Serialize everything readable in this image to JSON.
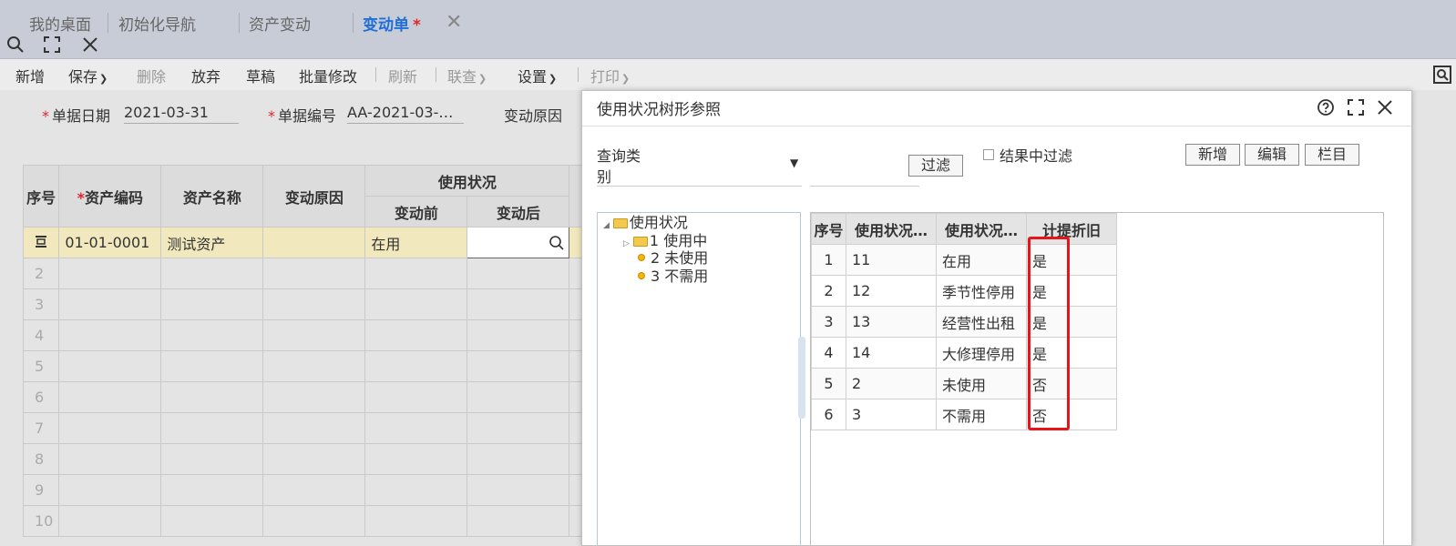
{
  "tabs": [
    {
      "label": "我的桌面"
    },
    {
      "label": "初始化导航"
    },
    {
      "label": "资产变动"
    },
    {
      "label": "变动单",
      "star": "*"
    }
  ],
  "toolbar": {
    "add": "新增",
    "save": "保存",
    "delete": "删除",
    "discard": "放弃",
    "draft": "草稿",
    "batch_edit": "批量修改",
    "refresh": "刷新",
    "link_query": "联查",
    "settings": "设置",
    "print": "打印"
  },
  "form": {
    "doc_date_label": "单据日期",
    "doc_date_value": "2021-03-31",
    "doc_no_label": "单据编号",
    "doc_no_value": "AA-2021-03-…",
    "reason_label": "变动原因",
    "required_mark": "*"
  },
  "grid": {
    "headers": {
      "seq": "序号",
      "asset_code": "资产编码",
      "asset_name": "资产名称",
      "reason": "变动原因",
      "usage": "使用状况",
      "before": "变动前",
      "after": "变动后"
    },
    "row1": {
      "code": "01-01-0001",
      "name": "测试资产",
      "before": "在用"
    },
    "row_numbers": [
      "2",
      "3",
      "4",
      "5",
      "6",
      "7",
      "8",
      "9",
      "10"
    ]
  },
  "dialog": {
    "title": "使用状况树形参照",
    "query_label": "查询类别",
    "filter_button": "过滤",
    "filter_in_result": "结果中过滤",
    "add_button": "新增",
    "edit_button": "编辑",
    "columns_button": "栏目",
    "tree": {
      "root": "使用状况",
      "nodes": [
        "1 使用中",
        "2 未使用",
        "3 不需用"
      ]
    },
    "list": {
      "headers": [
        "序号",
        "使用状况…",
        "使用状况…",
        "计提折旧"
      ],
      "rows": [
        [
          "1",
          "11",
          "在用",
          "是"
        ],
        [
          "2",
          "12",
          "季节性停用",
          "是"
        ],
        [
          "3",
          "13",
          "经营性出租",
          "是"
        ],
        [
          "4",
          "14",
          "大修理停用",
          "是"
        ],
        [
          "5",
          "2",
          "未使用",
          "否"
        ],
        [
          "6",
          "3",
          "不需用",
          "否"
        ]
      ]
    }
  }
}
